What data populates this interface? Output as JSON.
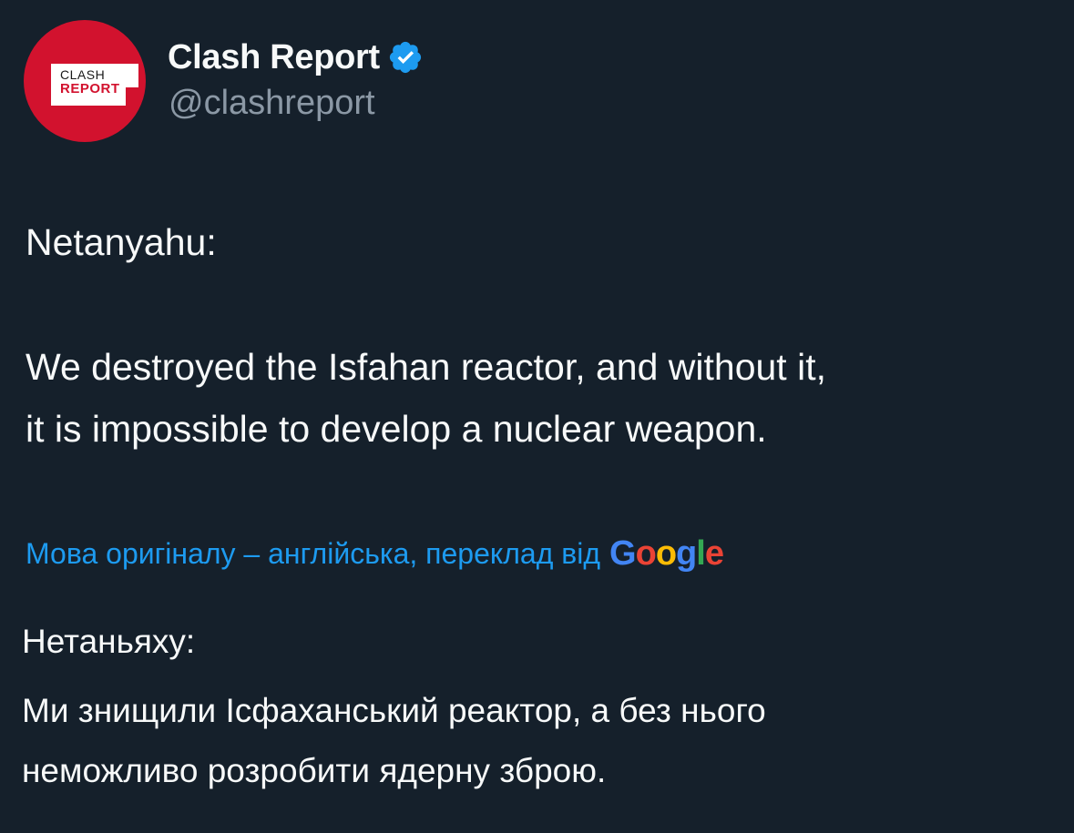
{
  "author": {
    "display_name": "Clash Report",
    "handle": "@clashreport",
    "avatar_logo_line1": "CLASH",
    "avatar_logo_line2": "REPORT",
    "verified": true,
    "avatar_color": "#d2122e",
    "badge_color": "#1d9bf0"
  },
  "tweet": {
    "line1": "Netanyahu:",
    "line2": "We destroyed the Isfahan reactor, and without it,",
    "line3": "it is impossible to develop a nuclear weapon."
  },
  "translation": {
    "label": "Мова оригіналу – англійська, переклад від",
    "provider_letters": [
      "G",
      "o",
      "o",
      "g",
      "l",
      "e"
    ],
    "line1": "Нетаньяху:",
    "line2": "Ми знищили Ісфаханський реактор, а без нього",
    "line3": "неможливо розробити ядерну зброю."
  },
  "colors": {
    "background": "#15202b",
    "text": "#f7f9f9",
    "secondary_text": "#8b98a5",
    "link": "#1d9bf0"
  }
}
